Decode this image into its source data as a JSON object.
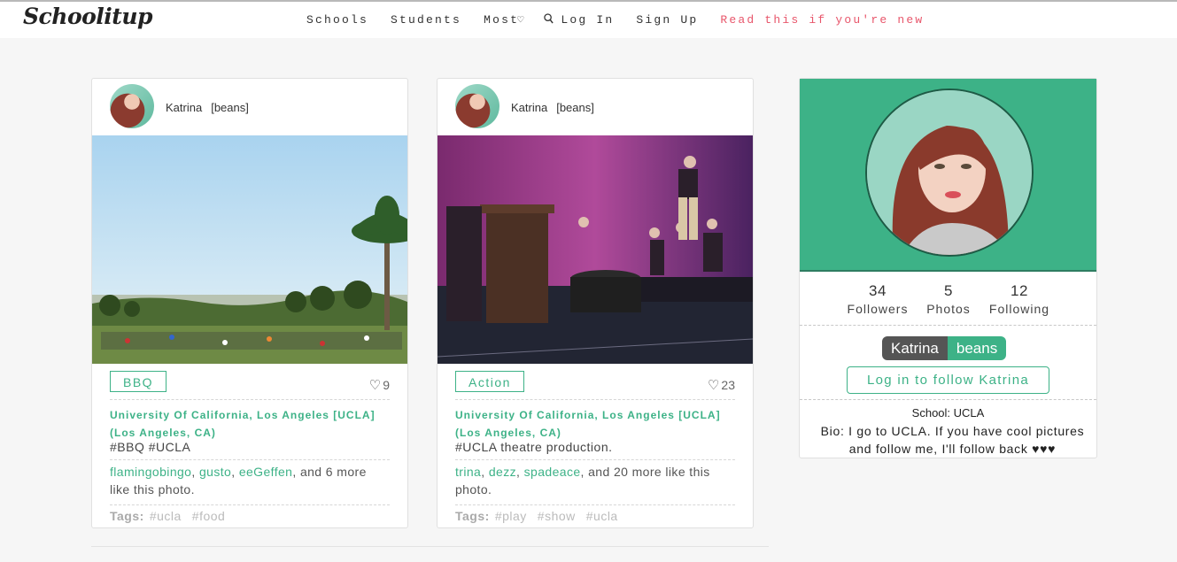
{
  "nav": {
    "logo": "Schoolitup",
    "schools": "Schools",
    "students": "Students",
    "most": "Most",
    "login": "Log In",
    "signup": "Sign Up",
    "new_users": "Read this if you're new"
  },
  "posts": [
    {
      "user": "Katrina",
      "nick": "[beans]",
      "category": "BBQ",
      "likes": "9",
      "school": "University Of California, Los Angeles [UCLA] (Los Angeles, CA)",
      "caption": "#BBQ #UCLA",
      "liker1": "flamingobingo",
      "liker2": "gusto",
      "liker3": "eeGeffen",
      "likers_suffix": ", and 6 more like this photo.",
      "tags_label": "Tags:",
      "tag1": "#ucla",
      "tag2": "#food",
      "tag3": ""
    },
    {
      "user": "Katrina",
      "nick": "[beans]",
      "category": "Action",
      "likes": "23",
      "school": "University Of California, Los Angeles [UCLA] (Los Angeles, CA)",
      "caption": "#UCLA theatre production.",
      "liker1": "trina",
      "liker2": "dezz",
      "liker3": "spadeace",
      "likers_suffix": ", and 20 more like this photo.",
      "tags_label": "Tags:",
      "tag1": "#play",
      "tag2": "#show",
      "tag3": "#ucla"
    }
  ],
  "profile": {
    "followers_count": "34",
    "followers_label": "Followers",
    "photos_count": "5",
    "photos_label": "Photos",
    "following_count": "12",
    "following_label": "Following",
    "first_name": "Katrina",
    "nick": "beans",
    "follow_button": "Log in to follow Katrina",
    "school": "School: UCLA",
    "bio": "Bio: I go to UCLA. If you have cool pictures and follow me, I'll follow back ♥♥♥"
  },
  "colors": {
    "accent": "#3db287",
    "new_link": "#e8566b"
  }
}
